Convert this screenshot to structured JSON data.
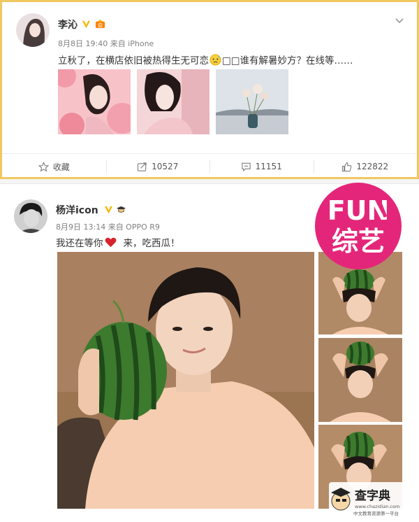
{
  "post1": {
    "user_name": "李沁",
    "time": "8月8日 19:40 来自 iPhone",
    "text_before_emoji": "立秋了，在横店依旧被热得生无可恋",
    "text_after_emoji": "□□谁有解暑妙方？在线等……",
    "actions": {
      "favorite_label": "收藏",
      "repost_count": "10527",
      "comment_count": "11151",
      "like_count": "122822"
    }
  },
  "post2": {
    "user_name": "杨洋icon",
    "time": "8月9日 13:14 来自 OPPO R9",
    "text_before_heart": "我还在等你",
    "text_after_heart": "来，吃西瓜！"
  },
  "watermark": {
    "fun_label": "FUN",
    "fun_cn_label": "综艺",
    "site_name": "查字典",
    "site_url": "www.chazidian.com",
    "site_tagline": "中文教育资源第一平台"
  },
  "colors": {
    "verified_gold": "#f7b500",
    "fun_magenta": "#e4267a",
    "card_border": "#f0c860"
  }
}
